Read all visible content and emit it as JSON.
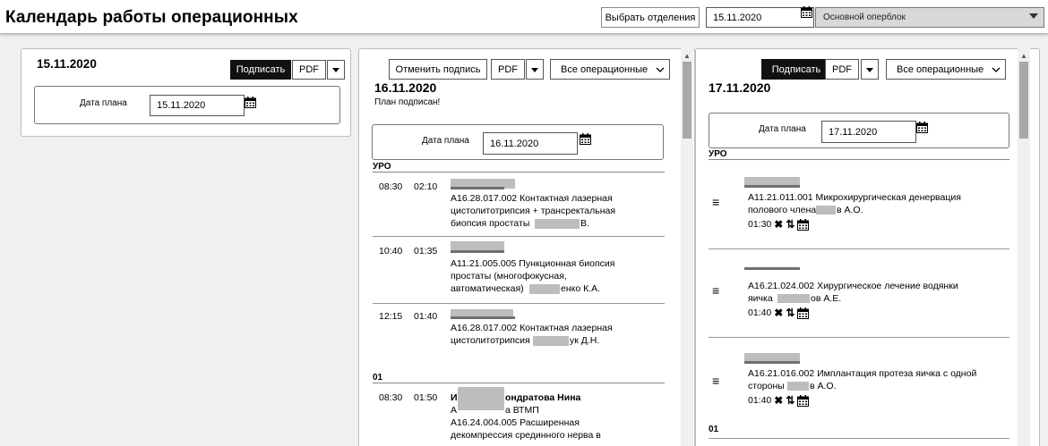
{
  "header": {
    "title": "Календарь работы операционных",
    "select_dept_label": "Выбрать отделения",
    "date_value": "15.11.2020",
    "block_select": "Основной оперблок"
  },
  "col1": {
    "date": "15.11.2020",
    "sign_label": "Подписать",
    "pdf_label": "PDF",
    "plan_date_label": "Дата плана",
    "plan_date_value": "15.11.2020"
  },
  "col2": {
    "date": "16.11.2020",
    "status": "План подписан!",
    "cancel_sign_label": "Отменить подпись",
    "pdf_label": "PDF",
    "filter_label": "Все операционные",
    "plan_date_label": "Дата плана",
    "plan_date_value": "16.11.2020",
    "section1": "УРО",
    "section2": "01",
    "ops": [
      {
        "time": "08:30",
        "dur": "02:10",
        "l1": "A16.28.017.002 Контактная лазерная",
        "l2": "цистолитотрипсия + трансректальная",
        "l3": "биопсия простаты",
        "l3b": "В."
      },
      {
        "time": "10:40",
        "dur": "01:35",
        "l1": "A11.21.005.005 Пункционная биопсия",
        "l2": "простаты (многофокусная,",
        "l3": "автоматическая)",
        "l3b": "енко К.А."
      },
      {
        "time": "12:15",
        "dur": "01:40",
        "l1": "A16.28.017.002 Контактная лазерная",
        "l2": "цистолитотрипсия",
        "l2b": "ук Д.Н.",
        "l3": ""
      },
      {
        "time": "08:30",
        "dur": "01:50",
        "l0a": "И",
        "l0b": "ондратова Нина",
        "l1a": "А",
        "l1b": "а ВТМП",
        "l2": "A16.24.004.005 Расширенная",
        "l3": "декомпрессия срединного нерва в"
      }
    ]
  },
  "col3": {
    "date": "17.11.2020",
    "sign_label": "Подписать",
    "pdf_label": "PDF",
    "filter_label": "Все операционные",
    "plan_date_label": "Дата плана",
    "plan_date_value": "17.11.2020",
    "section1": "УРО",
    "section2": "01",
    "ops": [
      {
        "l1": "A11.21.011.001 Микрохирургическая денервация",
        "l2a": "полового члена",
        "l2b": "в А.О.",
        "dur": "01:30"
      },
      {
        "l1": "A16.21.024.002 Хирургическое лечение водянки",
        "l2a": "яичка",
        "l2b": "ов А.Е.",
        "dur": "01:40"
      },
      {
        "l1": "A16.21.016.002 Имплантация протеза яичка с одной",
        "l2a": "стороны",
        "l2b": "в А.О.",
        "dur": "01:40"
      }
    ]
  }
}
